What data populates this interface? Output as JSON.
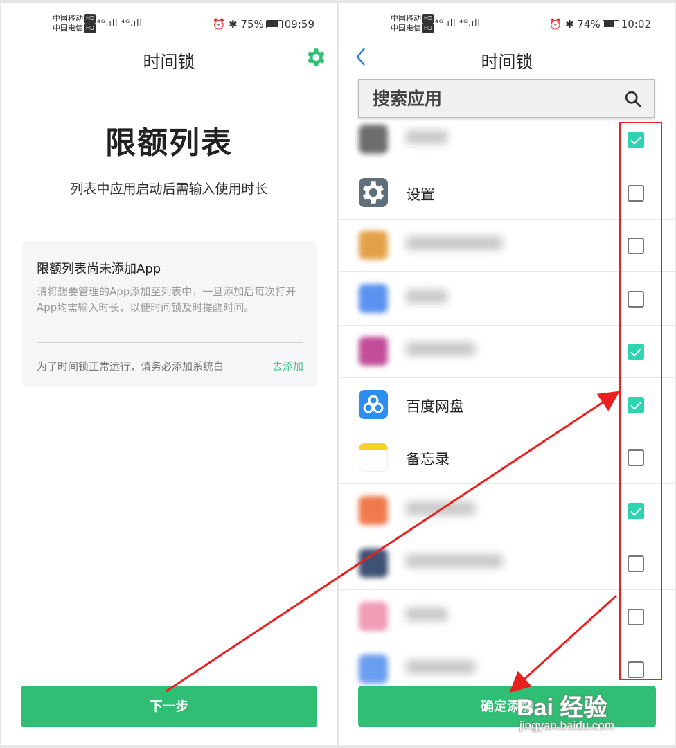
{
  "left": {
    "status": {
      "carrier1": "中国移动",
      "carrier2": "中国电信",
      "hd": "HD",
      "signal": "⁴ᴳ.ıll ⁴ᴳ.ıll",
      "battery": "75%",
      "time": "09:59"
    },
    "title": "时间锁",
    "big_title": "限额列表",
    "subtitle": "列表中应用启动后需输入使用时长",
    "card": {
      "title": "限额列表尚未添加App",
      "desc": "请将想要管理的App添加至列表中，一旦添加后每次打开App均需输入时长，以便时间锁及时提醒时间。",
      "footer": "为了时间锁正常运行，请务必添加系统白",
      "link": "去添加"
    },
    "next_button": "下一步"
  },
  "right": {
    "status": {
      "carrier1": "中国移动",
      "carrier2": "中国电信",
      "hd": "HD",
      "signal": "⁴ᴳ.ıll ⁴ᴳ.ıll",
      "battery": "74%",
      "time": "10:02"
    },
    "title": "时间锁",
    "search_placeholder": "搜索应用",
    "apps": [
      {
        "name": "",
        "icon_color": "#6d6d6d",
        "checked": true
      },
      {
        "name": "设置",
        "icon_color": "#5f6f7b",
        "checked": false
      },
      {
        "name": "",
        "icon_color": "#e3a24a",
        "checked": false
      },
      {
        "name": "",
        "icon_color": "#5b93f0",
        "checked": false
      },
      {
        "name": "",
        "icon_color": "#c24e9a",
        "checked": true
      },
      {
        "name": "百度网盘",
        "icon_color": "#2d8ef0",
        "checked": true
      },
      {
        "name": "备忘录",
        "icon_color": "#f8d21c",
        "checked": false
      },
      {
        "name": "",
        "icon_color": "#ef7a4c",
        "checked": true
      },
      {
        "name": "",
        "icon_color": "#3f5274",
        "checked": false
      },
      {
        "name": "",
        "icon_color": "#ef9cb5",
        "checked": false
      },
      {
        "name": "",
        "icon_color": "#6a9ef0",
        "checked": false
      }
    ],
    "confirm_button": "确定添加"
  },
  "annotation_color": "#e8201e",
  "watermark": {
    "logo": "Bai 经验",
    "url": "jingyan.baidu.com"
  }
}
